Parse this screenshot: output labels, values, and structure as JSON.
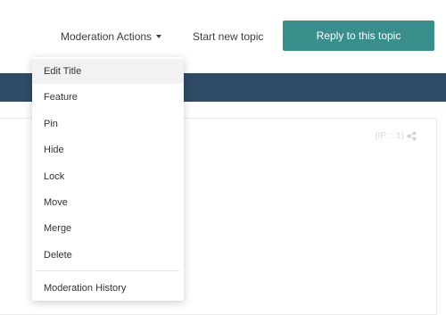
{
  "toolbar": {
    "moderation_actions_label": "Moderation Actions",
    "start_new_topic_label": "Start new topic",
    "reply_label": "Reply to this topic"
  },
  "post": {
    "ip_text": "(IP: ::1)"
  },
  "menu": {
    "items": [
      {
        "label": "Edit Title",
        "active": true
      },
      {
        "label": "Feature"
      },
      {
        "label": "Pin"
      },
      {
        "label": "Hide"
      },
      {
        "label": "Lock"
      },
      {
        "label": "Move"
      },
      {
        "label": "Merge"
      },
      {
        "label": "Delete"
      }
    ],
    "history_label": "Moderation History"
  },
  "colors": {
    "reply_button_bg": "#3a8f8c",
    "header_band": "#2f4b66",
    "menu_active_bg": "#f2f2f2"
  },
  "icons": {
    "caret": "caret-down-icon",
    "share": "share-icon"
  }
}
